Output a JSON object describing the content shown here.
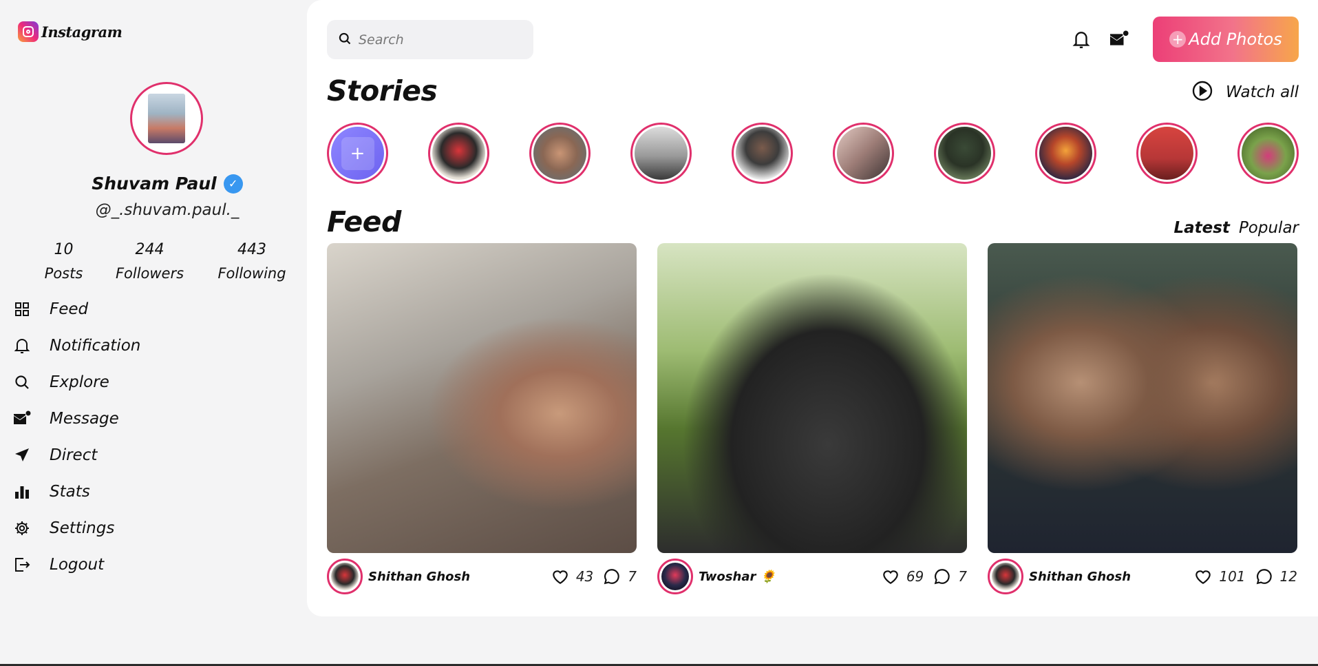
{
  "app": {
    "name": "Instagram"
  },
  "profile": {
    "name": "Shuvam Paul",
    "handle": "@_.shuvam.paul._",
    "stats": [
      {
        "value": "10",
        "label": "Posts"
      },
      {
        "value": "244",
        "label": "Followers"
      },
      {
        "value": "443",
        "label": "Following"
      }
    ]
  },
  "menu": {
    "items": [
      {
        "label": "Feed",
        "icon": "grid-icon"
      },
      {
        "label": "Notification",
        "icon": "bell-icon"
      },
      {
        "label": "Explore",
        "icon": "search-icon"
      },
      {
        "label": "Message",
        "icon": "mail-icon"
      },
      {
        "label": "Direct",
        "icon": "send-icon"
      },
      {
        "label": "Stats",
        "icon": "bar-chart-icon"
      },
      {
        "label": "Settings",
        "icon": "gear-icon"
      },
      {
        "label": "Logout",
        "icon": "logout-icon"
      }
    ]
  },
  "header": {
    "search_placeholder": "Search",
    "add_photos_label": "Add Photos"
  },
  "stories": {
    "title": "Stories",
    "watch_all_label": "Watch all",
    "add_symbol": "+"
  },
  "feed": {
    "title": "Feed",
    "tabs": [
      {
        "label": "Latest",
        "active": true
      },
      {
        "label": "Popular",
        "active": false
      }
    ],
    "posts": [
      {
        "author": "Shithan Ghosh",
        "likes": "43",
        "comments": "7"
      },
      {
        "author": "Twoshar 🌻",
        "likes": "69",
        "comments": "7"
      },
      {
        "author": "Shithan Ghosh",
        "likes": "101",
        "comments": "12"
      }
    ]
  },
  "colors": {
    "accent_ring": "#e0306c",
    "add_button_gradient_start": "#ec3f77",
    "add_button_gradient_end": "#f7a64a",
    "verified": "#3897f0"
  }
}
